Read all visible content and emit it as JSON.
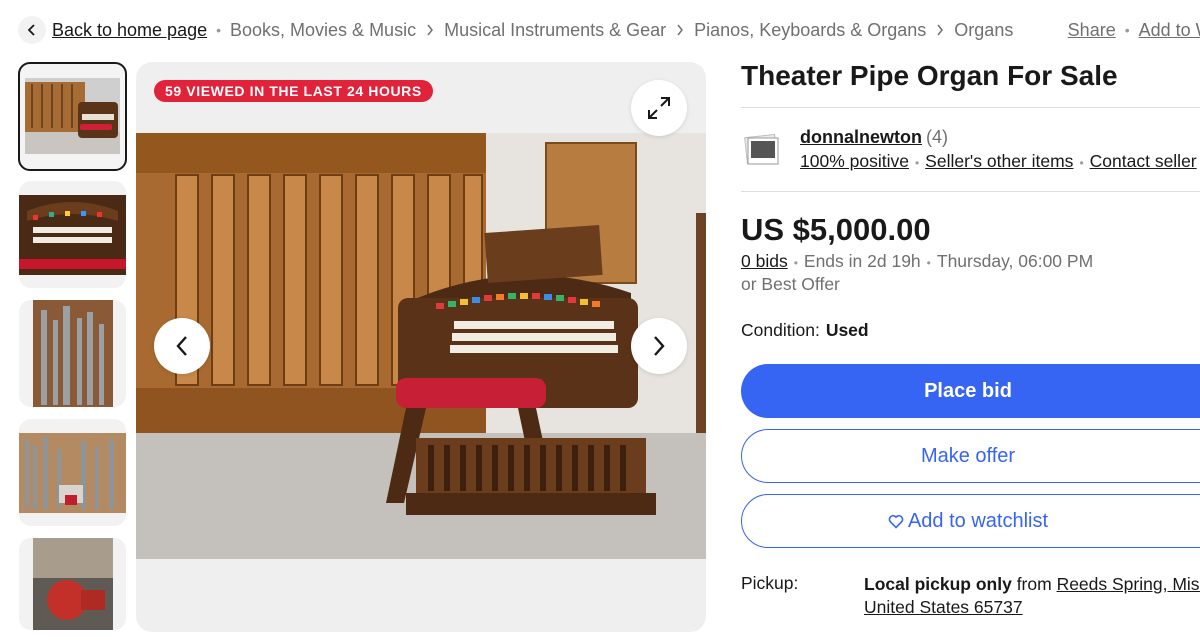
{
  "breadcrumb": {
    "back_label": "Back to home page",
    "items": [
      "Books, Movies & Music",
      "Musical Instruments & Gear",
      "Pianos, Keyboards & Organs",
      "Organs"
    ],
    "share_label": "Share",
    "watchlist_label": "Add to Wa"
  },
  "gallery": {
    "viewed_badge": "59 VIEWED IN THE LAST 24 HOURS",
    "thumbnail_count": 5,
    "selected_index": 0
  },
  "listing": {
    "title": "Theater Pipe Organ For Sale",
    "seller": {
      "name": "donnalnewton",
      "feedback_count": "(4)",
      "positive": "100% positive",
      "other_items": "Seller's other items",
      "contact": "Contact seller"
    },
    "price": "US $5,000.00",
    "bids": "0 bids",
    "ends_in": "Ends in 2d 19h",
    "end_time": "Thursday, 06:00 PM",
    "best_offer": "or Best Offer",
    "condition_label": "Condition:",
    "condition_value": "Used",
    "buttons": {
      "place_bid": "Place bid",
      "make_offer": "Make offer",
      "add_watchlist": "Add to watchlist"
    },
    "pickup_label": "Pickup:",
    "pickup_type": "Local pickup only",
    "pickup_from": "from",
    "pickup_location": "Reeds Spring, Misso",
    "pickup_country": "United States 65737"
  },
  "colors": {
    "accent_blue": "#3665f3",
    "badge_red": "#e0223a",
    "text": "#191919",
    "muted": "#707070"
  }
}
